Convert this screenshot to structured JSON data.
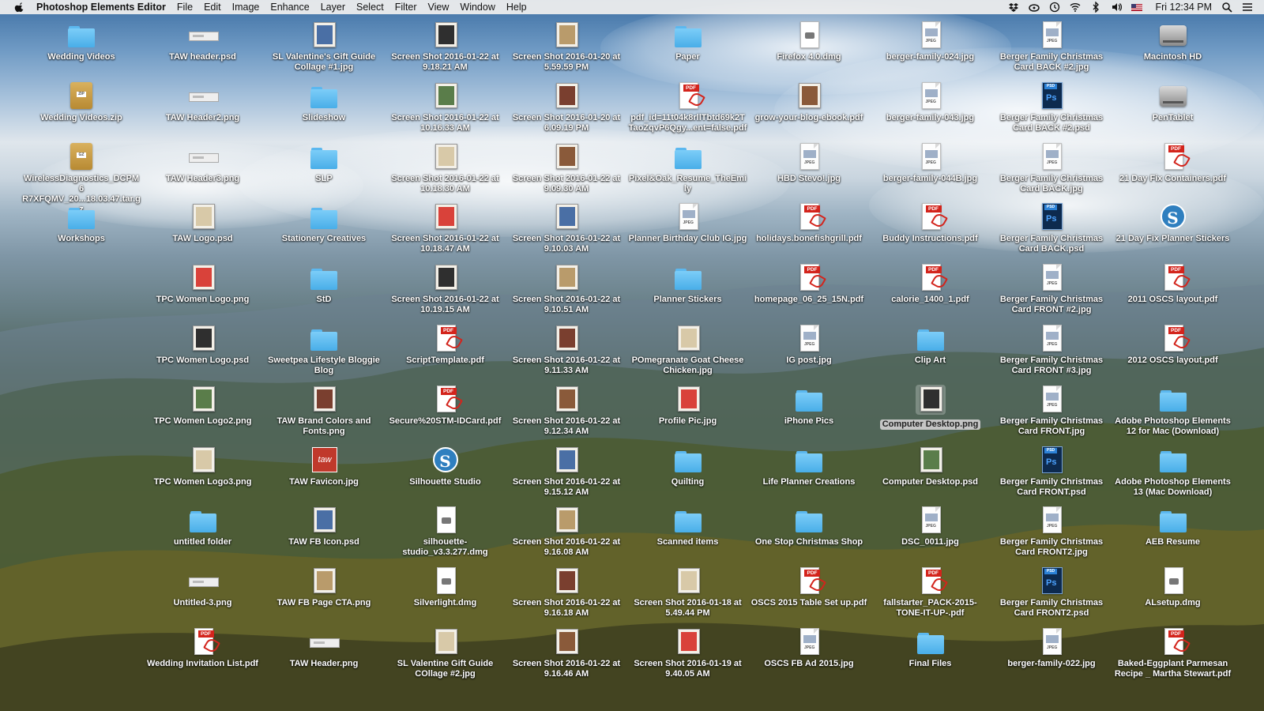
{
  "menubar": {
    "app_name": "Photoshop Elements Editor",
    "menus": [
      "File",
      "Edit",
      "Image",
      "Enhance",
      "Layer",
      "Select",
      "Filter",
      "View",
      "Window",
      "Help"
    ],
    "clock": "Fri 12:34 PM",
    "status_icons": [
      "dropbox-icon",
      "creative-cloud-icon",
      "time-machine-icon",
      "wifi-icon",
      "bluetooth-icon",
      "volume-icon",
      "flag-icon"
    ]
  },
  "desktop": {
    "items": [
      {
        "label": "Wedding Videos",
        "icon": "folder"
      },
      {
        "label": "TAW header.psd",
        "icon": "banner"
      },
      {
        "label": "SL Valentine's Gift Guide Collage #1.jpg",
        "icon": "shot"
      },
      {
        "label": "Screen Shot 2016-01-22 at 9.18.21 AM",
        "icon": "shot"
      },
      {
        "label": "Screen Shot 2016-01-20 at 5.59.59 PM",
        "icon": "shot"
      },
      {
        "label": "Paper",
        "icon": "folder"
      },
      {
        "label": "Firefox 4.0.dmg",
        "icon": "dmg"
      },
      {
        "label": "berger-family-024.jpg",
        "icon": "jpeg"
      },
      {
        "label": "Berger Family Christmas Card BACK #2.jpg",
        "icon": "jpeg"
      },
      {
        "label": "Macintosh HD",
        "icon": "drive"
      },
      {
        "label": "Wedding Videos.zip",
        "icon": "zip"
      },
      {
        "label": "TAW Header2.png",
        "icon": "banner"
      },
      {
        "label": "Slideshow",
        "icon": "folder"
      },
      {
        "label": "Screen Shot 2016-01-22 at 10.16.33 AM",
        "icon": "shot"
      },
      {
        "label": "Screen Shot 2016-01-20 at 6.09.19 PM",
        "icon": "shot"
      },
      {
        "label": "pdf_id=11t04k8rllTbtd69k2T TaoZqvP6Qgy...ent=false.pdf",
        "icon": "pdf"
      },
      {
        "label": "grow-your-blog-ebook.pdf",
        "icon": "shot"
      },
      {
        "label": "berger-family-043.jpg",
        "icon": "jpeg"
      },
      {
        "label": "Berger Family Christmas Card BACK #2.psd",
        "icon": "psd"
      },
      {
        "label": "PenTablet",
        "icon": "drive"
      },
      {
        "label": "WirelessDiagnostics_DCPM6 R7XFQMV_20...18.03.47.tar.gz",
        "icon": "gz"
      },
      {
        "label": "TAW Header3.png",
        "icon": "banner"
      },
      {
        "label": "SLP",
        "icon": "folder"
      },
      {
        "label": "Screen Shot 2016-01-22 at 10.18.30 AM",
        "icon": "shot"
      },
      {
        "label": "Screen Shot 2016-01-22 at 9.09.30 AM",
        "icon": "shot"
      },
      {
        "label": "Pixel&Oak_Resume_TheEmily",
        "icon": "folder"
      },
      {
        "label": "HBD Stevo!.jpg",
        "icon": "jpeg"
      },
      {
        "label": "berger-family-044B.jpg",
        "icon": "jpeg"
      },
      {
        "label": "Berger Family Christmas Card BACK.jpg",
        "icon": "jpeg"
      },
      {
        "label": "21 Day Fix Containers.pdf",
        "icon": "pdf"
      },
      {
        "label": "Workshops",
        "icon": "folder"
      },
      {
        "label": "TAW Logo.psd",
        "icon": "shot"
      },
      {
        "label": "Stationery Creatives",
        "icon": "folder"
      },
      {
        "label": "Screen Shot 2016-01-22 at 10.18.47 AM",
        "icon": "shot"
      },
      {
        "label": "Screen Shot 2016-01-22 at 9.10.03 AM",
        "icon": "shot"
      },
      {
        "label": "Planner Birthday Club IG.jpg",
        "icon": "jpeg"
      },
      {
        "label": "holidays.bonefishgrill.pdf",
        "icon": "pdf"
      },
      {
        "label": "Buddy Instructions.pdf",
        "icon": "pdf"
      },
      {
        "label": "Berger Family Christmas Card BACK.psd",
        "icon": "psd"
      },
      {
        "label": "21 Day Fix Planner Stickers",
        "icon": "app"
      },
      {
        "label": "",
        "icon": "none"
      },
      {
        "label": "TPC Women Logo.png",
        "icon": "shot"
      },
      {
        "label": "StD",
        "icon": "folder"
      },
      {
        "label": "Screen Shot 2016-01-22 at 10.19.15 AM",
        "icon": "shot"
      },
      {
        "label": "Screen Shot 2016-01-22 at 9.10.51 AM",
        "icon": "shot"
      },
      {
        "label": "Planner Stickers",
        "icon": "folder"
      },
      {
        "label": "homepage_06_25_15N.pdf",
        "icon": "pdf"
      },
      {
        "label": "calorie_1400_1.pdf",
        "icon": "pdf"
      },
      {
        "label": "Berger Family Christmas Card FRONT #2.jpg",
        "icon": "jpeg"
      },
      {
        "label": "2011 OSCS layout.pdf",
        "icon": "pdf"
      },
      {
        "label": "",
        "icon": "none"
      },
      {
        "label": "TPC Women Logo.psd",
        "icon": "shot"
      },
      {
        "label": "Sweetpea Lifestyle Bloggie Blog",
        "icon": "folder"
      },
      {
        "label": "ScriptTemplate.pdf",
        "icon": "pdf"
      },
      {
        "label": "Screen Shot 2016-01-22 at 9.11.33 AM",
        "icon": "shot"
      },
      {
        "label": "POmegranate Goat Cheese Chicken.jpg",
        "icon": "shot"
      },
      {
        "label": "IG post.jpg",
        "icon": "jpeg"
      },
      {
        "label": "Clip Art",
        "icon": "folder"
      },
      {
        "label": "Berger Family Christmas Card FRONT #3.jpg",
        "icon": "jpeg"
      },
      {
        "label": "2012 OSCS layout.pdf",
        "icon": "pdf"
      },
      {
        "label": "",
        "icon": "none"
      },
      {
        "label": "TPC Women Logo2.png",
        "icon": "shot"
      },
      {
        "label": "TAW Brand Colors and Fonts.png",
        "icon": "shot"
      },
      {
        "label": "Secure%20STM-IDCard.pdf",
        "icon": "pdf"
      },
      {
        "label": "Screen Shot 2016-01-22 at 9.12.34 AM",
        "icon": "shot"
      },
      {
        "label": "Profile Pic.jpg",
        "icon": "shot"
      },
      {
        "label": "iPhone Pics",
        "icon": "folder"
      },
      {
        "label": "Computer Desktop.png",
        "icon": "shot",
        "selected": true
      },
      {
        "label": "Berger Family Christmas Card FRONT.jpg",
        "icon": "jpeg"
      },
      {
        "label": "Adobe Photoshop Elements 12 for Mac (Download)",
        "icon": "folder"
      },
      {
        "label": "",
        "icon": "none"
      },
      {
        "label": "TPC Women Logo3.png",
        "icon": "shot"
      },
      {
        "label": "TAW Favicon.jpg",
        "icon": "red"
      },
      {
        "label": "Silhouette Studio",
        "icon": "app"
      },
      {
        "label": "Screen Shot 2016-01-22 at 9.15.12 AM",
        "icon": "shot"
      },
      {
        "label": "Quilting",
        "icon": "folder"
      },
      {
        "label": "Life Planner Creations",
        "icon": "folder"
      },
      {
        "label": "Computer Desktop.psd",
        "icon": "shot"
      },
      {
        "label": "Berger Family Christmas Card FRONT.psd",
        "icon": "psd"
      },
      {
        "label": "Adobe Photoshop Elements 13 (Mac Download)",
        "icon": "folder"
      },
      {
        "label": "",
        "icon": "none"
      },
      {
        "label": "untitled folder",
        "icon": "folder"
      },
      {
        "label": "TAW FB Icon.psd",
        "icon": "shot"
      },
      {
        "label": "silhouette-studio_v3.3.277.dmg",
        "icon": "dmg"
      },
      {
        "label": "Screen Shot 2016-01-22 at 9.16.08 AM",
        "icon": "shot"
      },
      {
        "label": "Scanned items",
        "icon": "folder"
      },
      {
        "label": "One Stop Christmas Shop",
        "icon": "folder"
      },
      {
        "label": "DSC_0011.jpg",
        "icon": "jpeg"
      },
      {
        "label": "Berger Family Christmas Card FRONT2.jpg",
        "icon": "jpeg"
      },
      {
        "label": "AEB Resume",
        "icon": "folder"
      },
      {
        "label": "",
        "icon": "none"
      },
      {
        "label": "Untitled-3.png",
        "icon": "banner"
      },
      {
        "label": "TAW FB Page CTA.png",
        "icon": "shot"
      },
      {
        "label": "Silverlight.dmg",
        "icon": "dmg"
      },
      {
        "label": "Screen Shot 2016-01-22 at 9.16.18 AM",
        "icon": "shot"
      },
      {
        "label": "Screen Shot 2016-01-18 at 5.49.44 PM",
        "icon": "shot"
      },
      {
        "label": "OSCS 2015 Table Set up.pdf",
        "icon": "pdf"
      },
      {
        "label": "fallstarter_PACK-2015-TONE-IT-UP-.pdf",
        "icon": "pdf"
      },
      {
        "label": "Berger Family Christmas Card FRONT2.psd",
        "icon": "psd"
      },
      {
        "label": "ALsetup.dmg",
        "icon": "dmg"
      },
      {
        "label": "",
        "icon": "none"
      },
      {
        "label": "Wedding Invitation List.pdf",
        "icon": "pdf"
      },
      {
        "label": "TAW Header.png",
        "icon": "banner"
      },
      {
        "label": "SL Valentine Gift Guide COllage #2.jpg",
        "icon": "shot"
      },
      {
        "label": "Screen Shot 2016-01-22 at 9.16.46 AM",
        "icon": "shot"
      },
      {
        "label": "Screen Shot 2016-01-19 at 9.40.05 AM",
        "icon": "shot"
      },
      {
        "label": "OSCS FB Ad 2015.jpg",
        "icon": "jpeg"
      },
      {
        "label": "Final Files",
        "icon": "folder"
      },
      {
        "label": "berger-family-022.jpg",
        "icon": "jpeg"
      },
      {
        "label": "Baked-Eggplant Parmesan Recipe _ Martha Stewart.pdf",
        "icon": "pdf"
      }
    ]
  }
}
